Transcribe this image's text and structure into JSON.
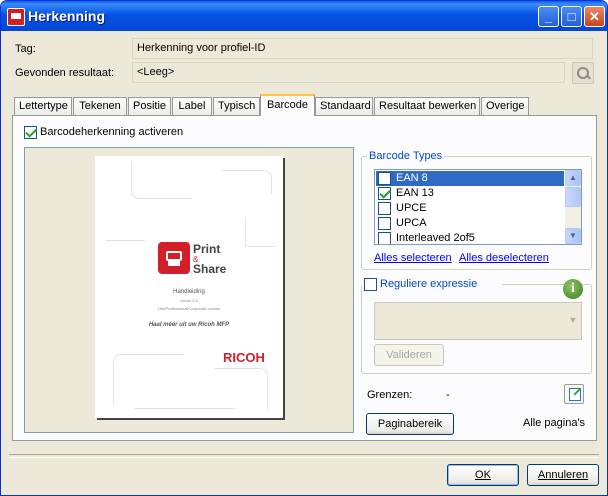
{
  "window": {
    "title": "Herkenning"
  },
  "fields": {
    "tag_label": "Tag:",
    "tag_value": "Herkenning voor profiel-ID",
    "result_label": "Gevonden resultaat:",
    "result_value": "<Leeg>"
  },
  "tabs": [
    "Lettertype",
    "Tekenen",
    "Positie",
    "Label",
    "Typisch",
    "Barcode",
    "Standaard",
    "Resultaat bewerken",
    "Overige"
  ],
  "active_tab": "Barcode",
  "barcode": {
    "enable_label": "Barcodeherkenning activeren",
    "enable_checked": true,
    "types_title": "Barcode Types",
    "types": [
      {
        "label": "EAN 8",
        "checked": false,
        "selected": true
      },
      {
        "label": "EAN 13",
        "checked": true,
        "selected": false
      },
      {
        "label": "UPCE",
        "checked": false,
        "selected": false
      },
      {
        "label": "UPCA",
        "checked": false,
        "selected": false
      },
      {
        "label": "Interleaved 2of5",
        "checked": false,
        "selected": false
      }
    ],
    "select_all": "Alles selecteren",
    "deselect_all": "Alles deselecteren",
    "regex_label": "Reguliere expressie",
    "regex_checked": false,
    "validate_btn": "Valideren",
    "bounds_label": "Grenzen:",
    "bounds_value": "-",
    "page_range_btn": "Paginabereik",
    "page_range_value": "Alle pagina's"
  },
  "document_preview": {
    "brand_line1": "Print",
    "brand_line2": "&",
    "brand_line3": "Share",
    "doc_title": "Handleiding",
    "doc_version": "versie 2.0",
    "doc_editions": "Lite/Professional/Corporate versies",
    "doc_tagline": "Haal méér uit uw Ricoh MFP",
    "maker_logo": "RICOH"
  },
  "buttons": {
    "ok": "OK",
    "cancel": "Annuleren"
  },
  "colors": {
    "titlebar": "#0553e3",
    "accent_link": "#0000ff",
    "selection": "#316ac5",
    "brand_red": "#d31f2a"
  }
}
